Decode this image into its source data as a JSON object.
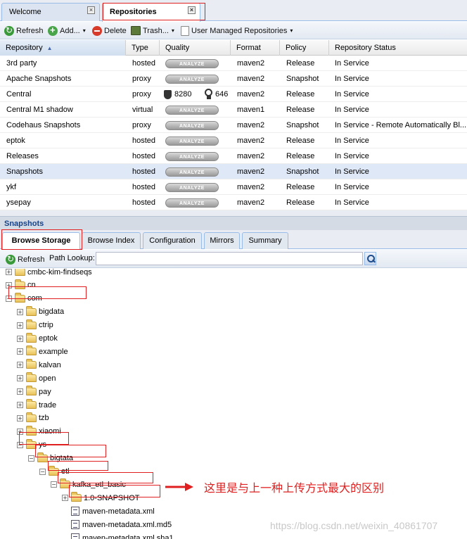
{
  "tabs": [
    {
      "label": "Welcome",
      "active": false
    },
    {
      "label": "Repositories",
      "active": true
    }
  ],
  "close_glyph": "×",
  "toolbar": {
    "refresh": "Refresh",
    "add": "Add...",
    "delete": "Delete",
    "trash": "Trash...",
    "user_managed": "User Managed Repositories",
    "dropdown_caret": "▾"
  },
  "grid": {
    "columns": [
      "Repository",
      "Type",
      "Quality",
      "Format",
      "Policy",
      "Repository Status"
    ],
    "sort_arrow": "▲",
    "analyze_label": "ANALYZE",
    "selected_row": 7,
    "rows": [
      {
        "repository": "3rd party",
        "type": "hosted",
        "quality": "ANALYZE",
        "format": "maven2",
        "policy": "Release",
        "status": "In Service"
      },
      {
        "repository": "Apache Snapshots",
        "type": "proxy",
        "quality": "ANALYZE",
        "format": "maven2",
        "policy": "Snapshot",
        "status": "In Service"
      },
      {
        "repository": "Central",
        "type": "proxy",
        "quality": "8280",
        "quality2": "646",
        "format": "maven2",
        "policy": "Release",
        "status": "In Service"
      },
      {
        "repository": "Central M1 shadow",
        "type": "virtual",
        "quality": "ANALYZE",
        "format": "maven1",
        "policy": "Release",
        "status": "In Service"
      },
      {
        "repository": "Codehaus Snapshots",
        "type": "proxy",
        "quality": "ANALYZE",
        "format": "maven2",
        "policy": "Snapshot",
        "status": "In Service - Remote Automatically Bl..."
      },
      {
        "repository": "eptok",
        "type": "hosted",
        "quality": "ANALYZE",
        "format": "maven2",
        "policy": "Release",
        "status": "In Service"
      },
      {
        "repository": "Releases",
        "type": "hosted",
        "quality": "ANALYZE",
        "format": "maven2",
        "policy": "Release",
        "status": "In Service"
      },
      {
        "repository": "Snapshots",
        "type": "hosted",
        "quality": "ANALYZE",
        "format": "maven2",
        "policy": "Snapshot",
        "status": "In Service"
      },
      {
        "repository": "ykf",
        "type": "hosted",
        "quality": "ANALYZE",
        "format": "maven2",
        "policy": "Release",
        "status": "In Service"
      },
      {
        "repository": "ysepay",
        "type": "hosted",
        "quality": "ANALYZE",
        "format": "maven2",
        "policy": "Release",
        "status": "In Service"
      }
    ]
  },
  "detail": {
    "title": "Snapshots",
    "tabs": [
      "Browse Storage",
      "Browse Index",
      "Configuration",
      "Mirrors",
      "Summary"
    ],
    "active_tab": 0,
    "refresh": "Refresh",
    "path_lookup_label": "Path Lookup:",
    "path_lookup_value": ""
  },
  "tree": [
    {
      "label": "cmbc-kim-findseqs",
      "kind": "folder",
      "depth": 1,
      "expander": "+"
    },
    {
      "label": "cn",
      "kind": "folder",
      "depth": 1,
      "expander": "+"
    },
    {
      "label": "com",
      "kind": "folder",
      "depth": 1,
      "expander": "−"
    },
    {
      "label": "bigdata",
      "kind": "folder",
      "depth": 2,
      "expander": "+"
    },
    {
      "label": "ctrip",
      "kind": "folder",
      "depth": 2,
      "expander": "+"
    },
    {
      "label": "eptok",
      "kind": "folder",
      "depth": 2,
      "expander": "+"
    },
    {
      "label": "example",
      "kind": "folder",
      "depth": 2,
      "expander": "+"
    },
    {
      "label": "kalvan",
      "kind": "folder",
      "depth": 2,
      "expander": "+"
    },
    {
      "label": "open",
      "kind": "folder",
      "depth": 2,
      "expander": "+"
    },
    {
      "label": "pay",
      "kind": "folder",
      "depth": 2,
      "expander": "+"
    },
    {
      "label": "trade",
      "kind": "folder",
      "depth": 2,
      "expander": "+"
    },
    {
      "label": "tzb",
      "kind": "folder",
      "depth": 2,
      "expander": "+"
    },
    {
      "label": "xiaomi",
      "kind": "folder",
      "depth": 2,
      "expander": "+"
    },
    {
      "label": "ys",
      "kind": "folder",
      "depth": 2,
      "expander": "−"
    },
    {
      "label": "bigtata",
      "kind": "folder",
      "depth": 3,
      "expander": "−"
    },
    {
      "label": "etl",
      "kind": "folder",
      "depth": 4,
      "expander": "−"
    },
    {
      "label": "kafka_etl_basic",
      "kind": "folder",
      "depth": 5,
      "expander": "−"
    },
    {
      "label": "1.0-SNAPSHOT",
      "kind": "folder",
      "depth": 6,
      "expander": "+"
    },
    {
      "label": "maven-metadata.xml",
      "kind": "file",
      "depth": 6,
      "expander": ""
    },
    {
      "label": "maven-metadata.xml.md5",
      "kind": "file",
      "depth": 6,
      "expander": ""
    },
    {
      "label": "maven-metadata.xml.sha1",
      "kind": "file",
      "depth": 6,
      "expander": ""
    }
  ],
  "annotation": {
    "text": "这里是与上一种上传方式最大的区别",
    "color": "#e02020"
  },
  "watermark": "https://blog.csdn.net/weixin_40861707",
  "colors": {
    "accent_border": "#99bbe8",
    "selected_row": "#dfe8f6",
    "highlight_box": "#e02020"
  }
}
